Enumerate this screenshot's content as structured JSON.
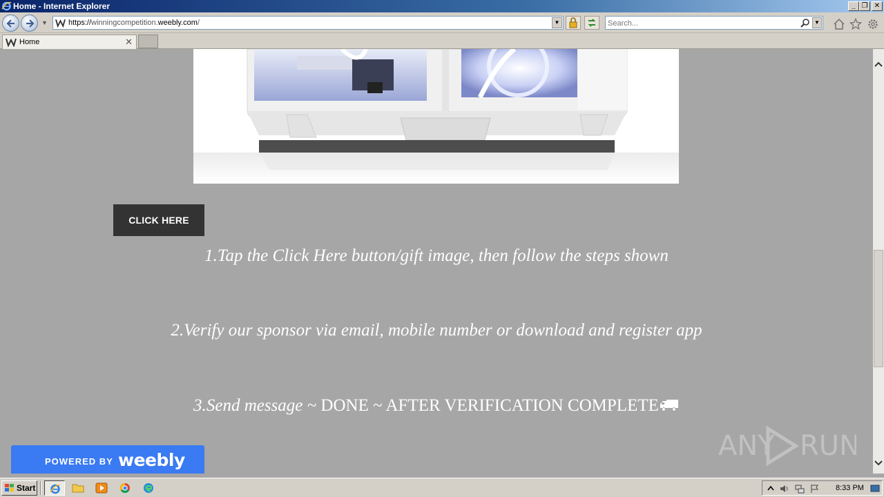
{
  "window": {
    "title": "Home - Internet Explorer"
  },
  "address_bar": {
    "url_prefix": "https://",
    "url_host_dim": "winningcompetition.",
    "url_host": "weebly.com",
    "url_suffix": "/"
  },
  "search": {
    "placeholder": "Search..."
  },
  "tabs": [
    {
      "label": "Home"
    }
  ],
  "page": {
    "cta_label": "CLICK HERE",
    "steps": [
      "1.Tap the Click Here button/gift image, then follow the steps shown",
      "2.Verify our sponsor via email, mobile number or download and register app",
      "3.Send message ~ DONE ~ AFTER VERIFICATION COMPLETE"
    ],
    "step3_italic": "3.Send message ~ ",
    "step3_upright": "DONE ~ AFTER VERIFICATION COMPLETE",
    "truck_icon": "truck-icon"
  },
  "badge": {
    "powered": "POWERED BY",
    "brand": "weebly"
  },
  "watermark": {
    "text_left": "ANY",
    "text_right": "RUN"
  },
  "taskbar": {
    "start_label": "Start",
    "clock": "8:33 PM"
  },
  "colors": {
    "page_background": "#a6a6a6",
    "button_dark": "#333333",
    "weebly_blue": "#3a7af2",
    "titlebar_start": "#0a246a"
  }
}
